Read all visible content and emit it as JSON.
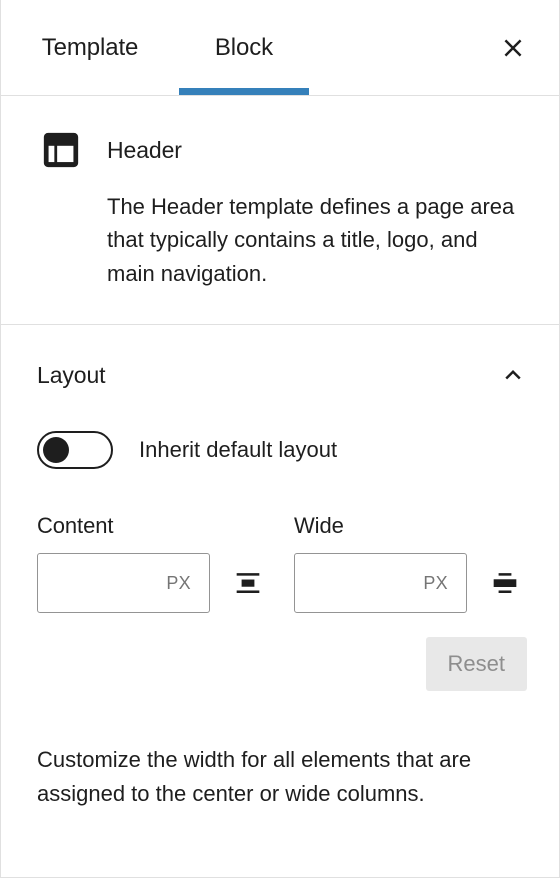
{
  "tabs": [
    {
      "label": "Template",
      "active": false,
      "name": "tab-template"
    },
    {
      "label": "Block",
      "active": true,
      "name": "tab-block"
    }
  ],
  "close": {
    "icon": "close-icon",
    "aria": "Close settings"
  },
  "block_info": {
    "icon": "header-block-icon",
    "title": "Header",
    "description": "The Header template defines a page area that typically contains a title, logo, and main navigation."
  },
  "layout_panel": {
    "title": "Layout",
    "expanded": true,
    "collapse_icon": "chevron-up-icon",
    "inherit_toggle": {
      "label": "Inherit default layout",
      "checked": false
    },
    "content_width": {
      "label": "Content",
      "value": "",
      "placeholder": "",
      "unit": "PX",
      "align_icon": "align-center-width-icon"
    },
    "wide_width": {
      "label": "Wide",
      "value": "",
      "placeholder": "",
      "unit": "PX",
      "align_icon": "align-wide-width-icon"
    },
    "reset_label": "Reset",
    "help_text": "Customize the width for all elements that are assigned to the center or wide columns."
  },
  "colors": {
    "accent": "#3580ba",
    "text": "#1e1e1e",
    "muted": "#757575",
    "border": "#e0e0e0",
    "input_border": "#949494",
    "disabled_bg": "#e8e8e8",
    "disabled_text": "#8e8e8e"
  }
}
